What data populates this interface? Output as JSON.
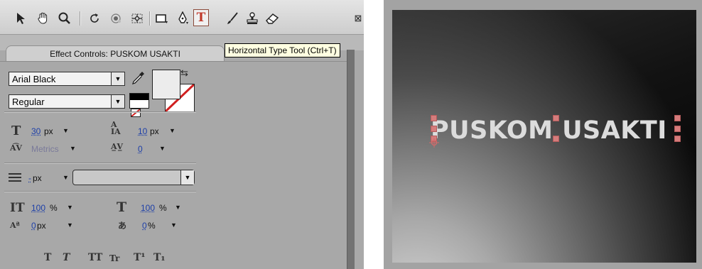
{
  "toolbar": {
    "tools": [
      "selection-tool",
      "hand-tool",
      "zoom-tool",
      "rotation-tool",
      "orbit-camera-tool",
      "pan-behind-tool",
      "rectangle-tool",
      "pen-tool",
      "horizontal-type-tool",
      "brush-tool",
      "clone-stamp-tool",
      "eraser-tool"
    ],
    "type_tool_glyph": "T",
    "tooltip": "Horizontal Type Tool (Ctrl+T)"
  },
  "panel": {
    "tab_label": "Effect Controls: PUSKOM USAKTI"
  },
  "character": {
    "font_family": "Arial Black",
    "font_style": "Regular",
    "font_size": "30",
    "font_size_unit": "px",
    "leading": "10",
    "leading_unit": "px",
    "kerning": "Metrics",
    "tracking": "0",
    "stroke_width": "-",
    "stroke_unit": "px",
    "stroke_option": "",
    "vertical_scale": "100",
    "vertical_scale_unit": "%",
    "horizontal_scale": "100",
    "horizontal_scale_unit": "%",
    "baseline_shift": "0",
    "baseline_shift_unit": "px",
    "tsume": "0",
    "tsume_unit": "%",
    "fill_color": "#ececec",
    "stroke_color": "none",
    "style_buttons": [
      "T",
      "T",
      "TT",
      "Tr",
      "T¹",
      "T₁"
    ]
  },
  "composition": {
    "text": "PUSKOM USAKTI",
    "text_color": "#dcdcdc"
  }
}
